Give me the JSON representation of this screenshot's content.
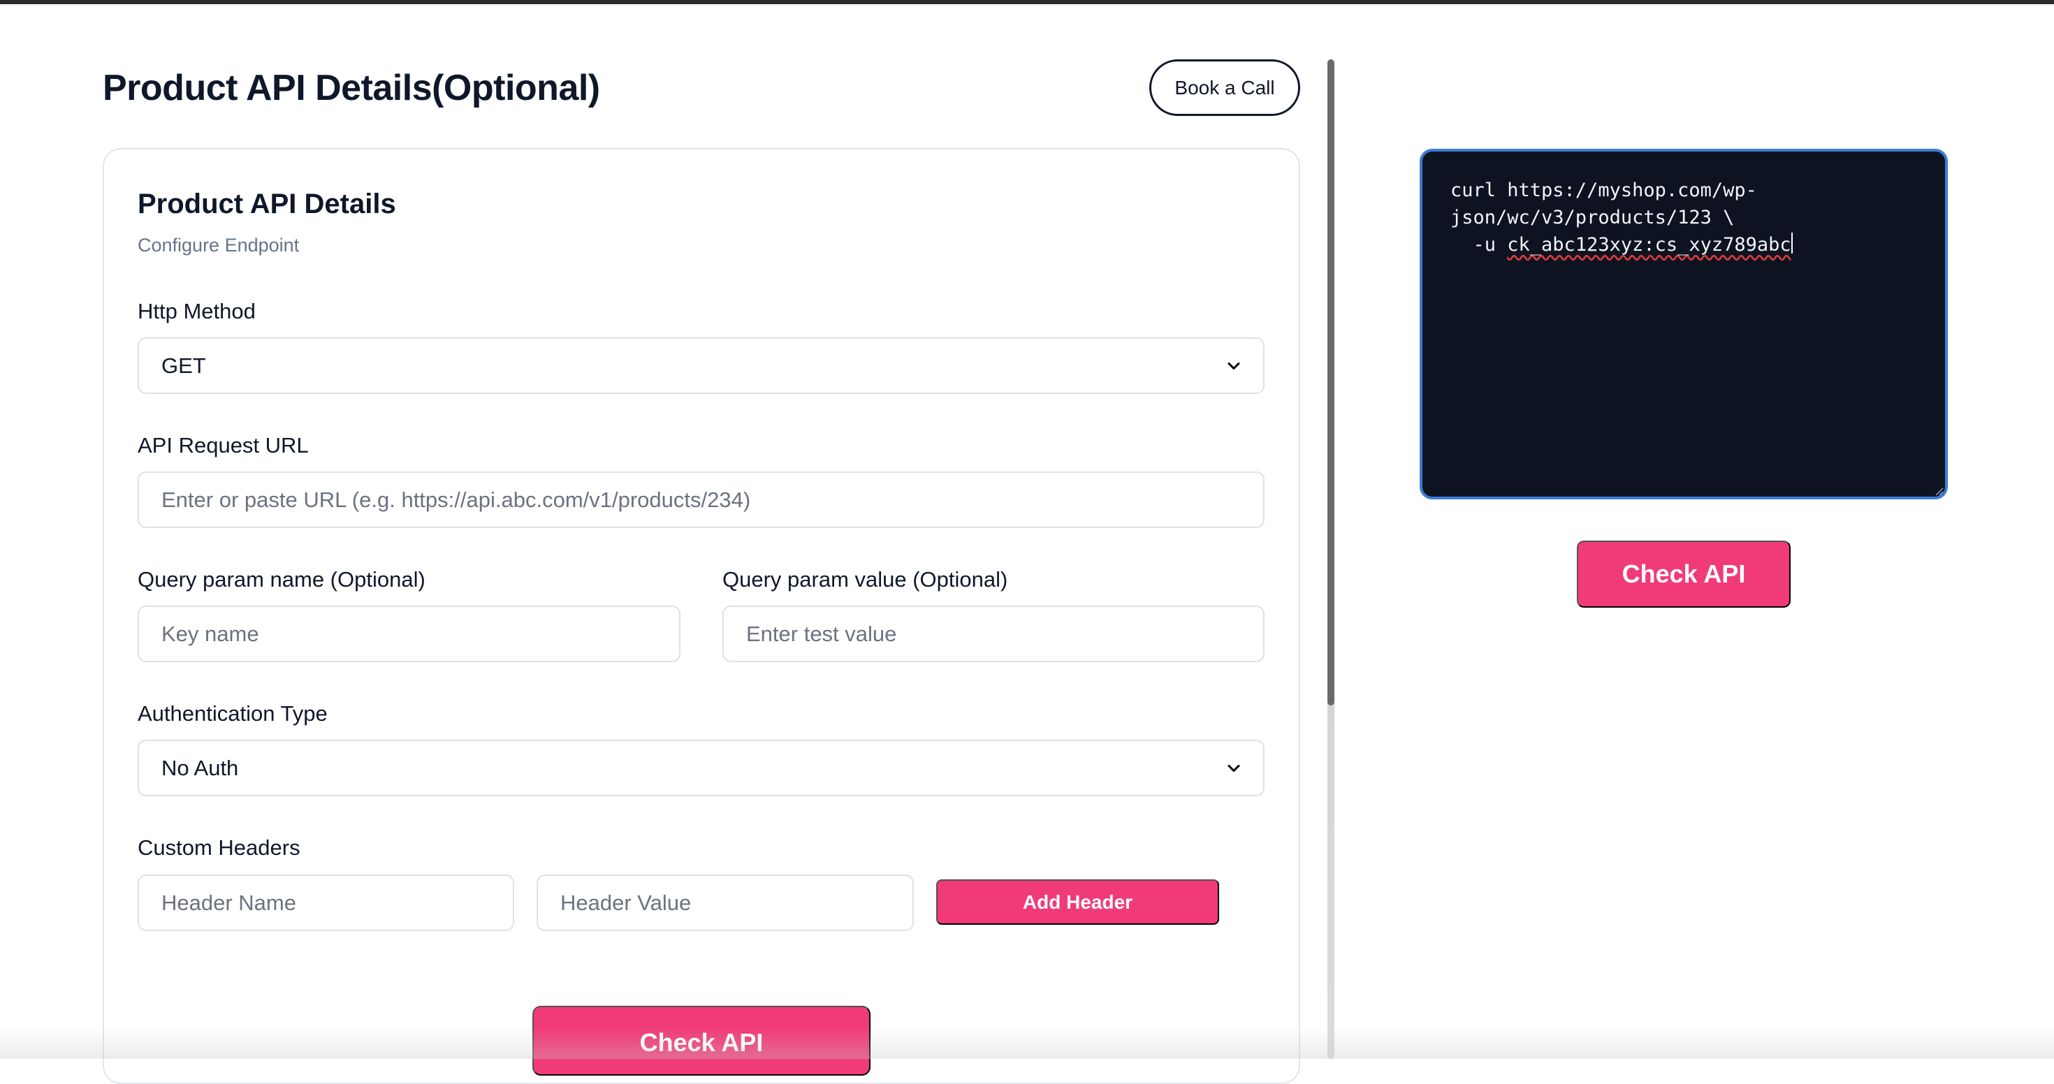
{
  "header": {
    "title": "Product API Details(Optional)",
    "book_call_label": "Book a Call"
  },
  "card": {
    "title": "Product API Details",
    "subtitle": "Configure Endpoint",
    "http_method": {
      "label": "Http Method",
      "value": "GET"
    },
    "request_url": {
      "label": "API Request URL",
      "placeholder": "Enter or paste URL (e.g. https://api.abc.com/v1/products/234)"
    },
    "query_name": {
      "label": "Query param name (Optional)",
      "placeholder": "Key name"
    },
    "query_value": {
      "label": "Query param value (Optional)",
      "placeholder": "Enter test value"
    },
    "auth_type": {
      "label": "Authentication Type",
      "value": "No Auth"
    },
    "custom_headers": {
      "label": "Custom Headers",
      "name_placeholder": "Header Name",
      "value_placeholder": "Header Value",
      "add_label": "Add Header"
    },
    "check_api_label": "Check API"
  },
  "code_panel": {
    "line1": "curl https://myshop.com/wp-",
    "line2": "json/wc/v3/products/123 \\",
    "line3_prefix": "  -u ",
    "line3_token": "ck_abc123xyz:cs_xyz789abc",
    "check_api_label": "Check API"
  },
  "colors": {
    "accent": "#f13a78",
    "code_bg": "#0e1321",
    "focus_border": "#3b7bd6"
  },
  "icons": {
    "select_chevron": "chevron-down-icon",
    "resize": "resize-handle-icon"
  }
}
